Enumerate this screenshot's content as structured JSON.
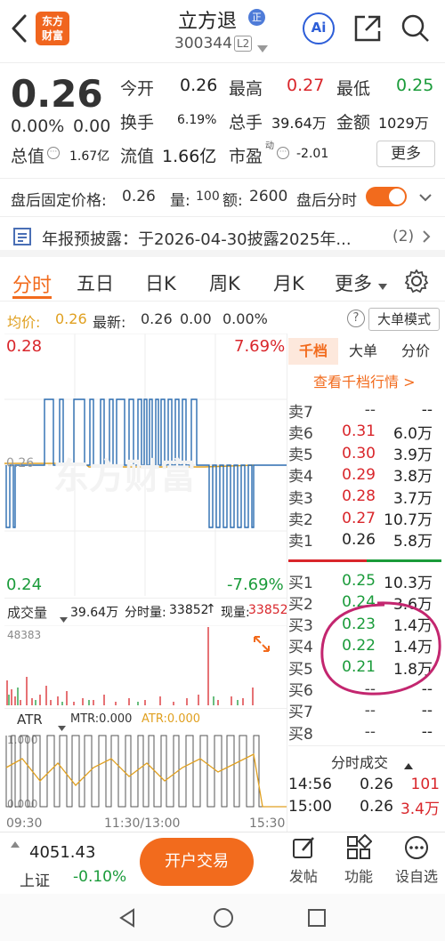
{
  "header": {
    "back_label": "<",
    "logo_line1": "东方",
    "logo_line2": "财富",
    "stock_name": "立方退",
    "badge": "正",
    "stock_code": "300344",
    "level": "L2",
    "ai_label": "Ai"
  },
  "quote": {
    "price": "0.26",
    "change_pct": "0.00%",
    "change_amt": "0.00",
    "open_label": "今开",
    "open": "0.26",
    "high_label": "最高",
    "high": "0.27",
    "low_label": "最低",
    "low": "0.25",
    "turnover_label": "换手",
    "turnover": "6.19%",
    "volume_label": "总手",
    "volume": "39.64万",
    "amount_label": "金额",
    "amount": "1029万",
    "mktcap_label": "总值",
    "mktcap": "1.67亿",
    "float_label": "流值",
    "float": "1.66亿",
    "pe_label": "市盈",
    "pe_sup": "动",
    "pe": "-2.01",
    "more_button": "更多"
  },
  "afterhours": {
    "price_label": "盘后固定价格:",
    "price": "0.26",
    "vol_label": "量:",
    "vol": "100",
    "amt_label": "额:",
    "amt": "2600",
    "toggle_label": "盘后分时"
  },
  "notice": {
    "text": "年报预披露：于2026-04-30披露2025年...",
    "count": "(2)"
  },
  "tabs": [
    "分时",
    "五日",
    "日K",
    "周K",
    "月K",
    "更多"
  ],
  "intraday": {
    "avg_label": "均价:",
    "avg": "0.26",
    "latest_label": "最新:",
    "latest": "0.26",
    "chg": "0.00",
    "chg_pct": "0.00%",
    "big_order_button": "大单模式",
    "y_top": "0.28",
    "y_top_pct": "7.69%",
    "y_mid": "0.26",
    "y_bottom": "0.24",
    "y_bottom_pct": "-7.69%",
    "watermark": "东方财富"
  },
  "volume_panel": {
    "label": "成交量",
    "total": "39.64万",
    "tick_label": "分时量:",
    "tick": "33852",
    "cur_label": "现量:",
    "cur": "33852",
    "max": "48383"
  },
  "atr_panel": {
    "label": "ATR",
    "mtr": "MTR:0.000",
    "atr": "ATR:0.000",
    "y_top": "1.000",
    "y_bottom": "0.000"
  },
  "time_axis": [
    "09:30",
    "11:30/13:00",
    "15:30"
  ],
  "orderbook": {
    "tabs": [
      "千档",
      "大单",
      "分价"
    ],
    "link": "查看千档行情 >",
    "asks": [
      {
        "label": "卖7",
        "price": "--",
        "vol": "--"
      },
      {
        "label": "卖6",
        "price": "0.31",
        "vol": "6.0万"
      },
      {
        "label": "卖5",
        "price": "0.30",
        "vol": "3.9万"
      },
      {
        "label": "卖4",
        "price": "0.29",
        "vol": "3.8万"
      },
      {
        "label": "卖3",
        "price": "0.28",
        "vol": "3.7万"
      },
      {
        "label": "卖2",
        "price": "0.27",
        "vol": "10.7万"
      },
      {
        "label": "卖1",
        "price": "0.26",
        "vol": "5.8万"
      }
    ],
    "bids": [
      {
        "label": "买1",
        "price": "0.25",
        "vol": "10.3万"
      },
      {
        "label": "买2",
        "price": "0.24",
        "vol": "3.6万"
      },
      {
        "label": "买3",
        "price": "0.23",
        "vol": "1.4万"
      },
      {
        "label": "买4",
        "price": "0.22",
        "vol": "1.4万"
      },
      {
        "label": "买5",
        "price": "0.21",
        "vol": "1.8万"
      },
      {
        "label": "买6",
        "price": "--",
        "vol": "--"
      },
      {
        "label": "买7",
        "price": "--",
        "vol": "--"
      },
      {
        "label": "买8",
        "price": "--",
        "vol": "--"
      }
    ],
    "trades_title": "分时成交",
    "trades": [
      {
        "time": "14:56",
        "price": "0.26",
        "vol": "101"
      },
      {
        "time": "15:00",
        "price": "0.26",
        "vol": "3.4万"
      }
    ]
  },
  "bottom": {
    "index_value": "4051.43",
    "index_name": "上证",
    "index_chg": "-0.10%",
    "open_account": "开户交易",
    "post": "发帖",
    "func": "功能",
    "watchlist": "设自选"
  },
  "colors": {
    "red": "#d9262b",
    "green": "#1a9b3a",
    "orange": "#f26b1d",
    "blue": "#2b6cb0"
  }
}
